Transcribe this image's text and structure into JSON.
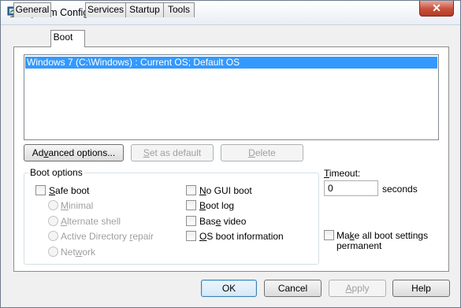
{
  "window": {
    "title": "System Configuration",
    "close_glyph": "✕",
    "app_icon": "msconfig-icon"
  },
  "tabs": [
    {
      "label": "General",
      "active": false
    },
    {
      "label": "Boot",
      "active": true
    },
    {
      "label": "Services",
      "active": false
    },
    {
      "label": "Startup",
      "active": false
    },
    {
      "label": "Tools",
      "active": false
    }
  ],
  "boot_list": {
    "items": [
      {
        "text": "Windows 7 (C:\\Windows) : Current OS; Default OS",
        "selected": true
      }
    ]
  },
  "list_buttons": {
    "advanced": "Advanced options...",
    "set_default": "Set as default",
    "delete": "Delete"
  },
  "boot_options": {
    "legend": "Boot options",
    "safe_boot": "Safe boot",
    "minimal": "Minimal",
    "alternate_shell": "Alternate shell",
    "active_directory_repair": "Active Directory repair",
    "network": "Network",
    "no_gui_boot": "No GUI boot",
    "boot_log": "Boot log",
    "base_video": "Base video",
    "os_boot_information": "OS boot information"
  },
  "timeout": {
    "label": "Timeout:",
    "value": "0",
    "unit": "seconds"
  },
  "permanent": {
    "label_line1": "Make all boot settings",
    "label_line2": "permanent"
  },
  "dialog_buttons": {
    "ok": "OK",
    "cancel": "Cancel",
    "apply": "Apply",
    "help": "Help"
  }
}
